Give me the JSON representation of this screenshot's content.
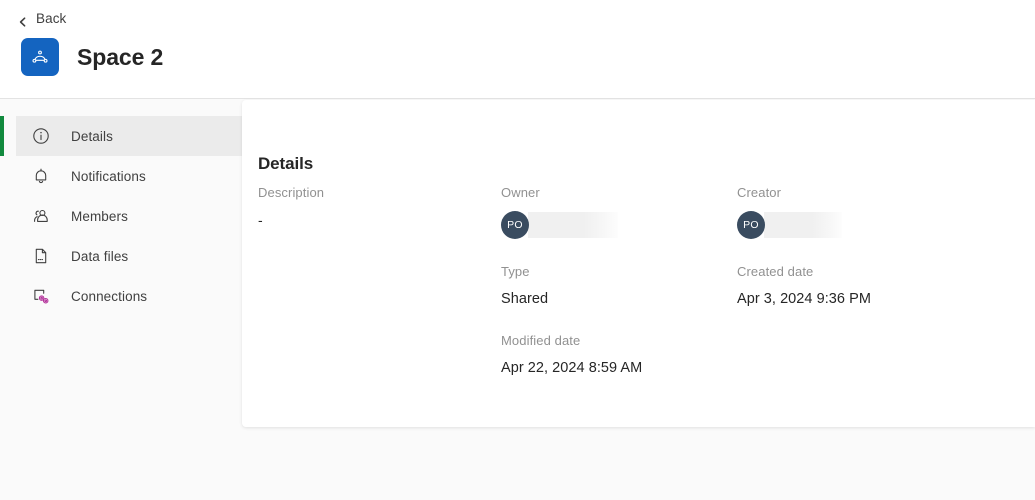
{
  "header": {
    "back_label": "Back",
    "back_icon": "chevron-left-icon",
    "space_icon": "space-logo-icon",
    "title": "Space 2",
    "brand_color": "#1464c0"
  },
  "sidebar": {
    "active_accent_color": "#128a3e",
    "items": [
      {
        "label": "Details",
        "icon": "info-circle-icon",
        "active": true
      },
      {
        "label": "Notifications",
        "icon": "bell-icon",
        "active": false
      },
      {
        "label": "Members",
        "icon": "people-icon",
        "active": false
      },
      {
        "label": "Data files",
        "icon": "file-icon",
        "active": false
      },
      {
        "label": "Connections",
        "icon": "connections-icon",
        "active": false
      }
    ]
  },
  "main": {
    "title": "Details",
    "fields": {
      "description": {
        "label": "Description",
        "value": "-"
      },
      "owner": {
        "label": "Owner",
        "avatar_initials": "PO",
        "value_redacted": true
      },
      "creator": {
        "label": "Creator",
        "avatar_initials": "PO",
        "value_redacted": true
      },
      "type": {
        "label": "Type",
        "value": "Shared"
      },
      "created_date": {
        "label": "Created date",
        "value": "Apr 3, 2024 9:36 PM"
      },
      "modified_date": {
        "label": "Modified date",
        "value": "Apr 22, 2024 8:59 AM"
      }
    }
  }
}
